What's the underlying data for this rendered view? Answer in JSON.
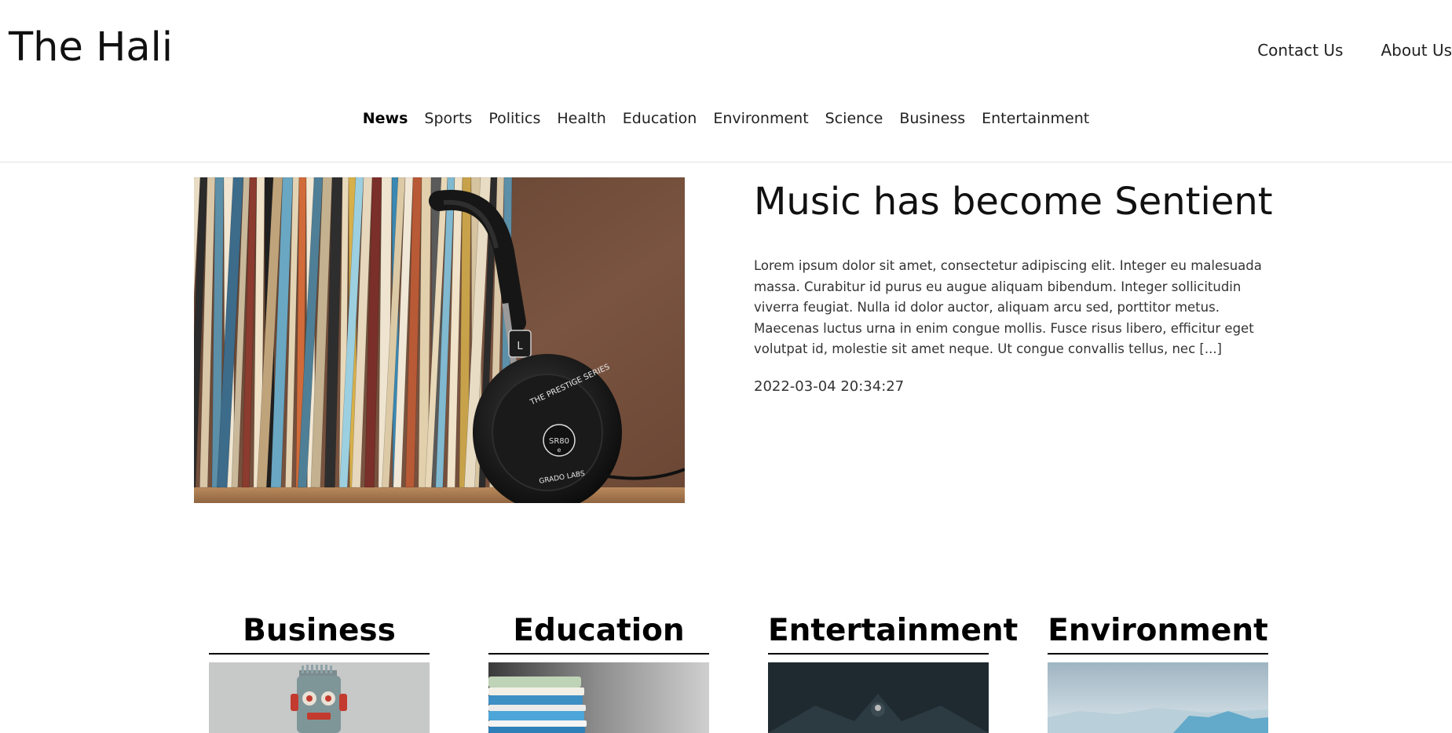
{
  "header": {
    "site_title": "The Hali",
    "links": [
      "Contact Us",
      "About Us"
    ],
    "nav": [
      "News",
      "Sports",
      "Politics",
      "Health",
      "Education",
      "Environment",
      "Science",
      "Business",
      "Entertainment"
    ],
    "active_nav": "News"
  },
  "featured": {
    "image_subject": "vinyl records and headphones",
    "headphone_text": {
      "series": "THE PRESTIGE SERIES",
      "model": "SR80",
      "sub": "e",
      "brand": "GRADO LABS",
      "side": "L"
    },
    "title": "Music has become Sentient",
    "excerpt": "Lorem ipsum dolor sit amet, consectetur adipiscing elit. Integer eu malesuada massa. Curabitur id purus eu augue aliquam bibendum. Integer sollicitudin viverra feugiat. Nulla id dolor auctor, aliquam arcu sed, porttitor metus. Maecenas luctus urna in enim congue mollis. Fusce risus libero, efficitur eget volutpat id, molestie sit amet neque. Ut congue convallis tellus, nec [...]",
    "date": "2022-03-04 20:34:27"
  },
  "sections": [
    {
      "heading": "Business",
      "image_subject": "toy robot"
    },
    {
      "heading": "Education",
      "image_subject": "stack of books"
    },
    {
      "heading": "Entertainment",
      "image_subject": "dark concert stage"
    },
    {
      "heading": "Environment",
      "image_subject": "iceberg"
    }
  ],
  "colors": {
    "text": "#111111",
    "divider": "#e2e2e2",
    "background": "#ffffff"
  }
}
